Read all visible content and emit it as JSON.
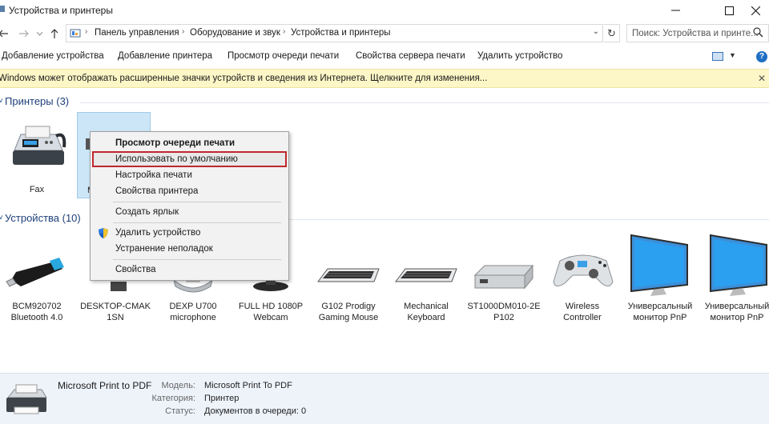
{
  "window": {
    "title": "Устройства и принтеры",
    "minimize_icon": "minimize-icon",
    "maximize_icon": "maximize-icon",
    "close_icon": "close-icon"
  },
  "address_bar": {
    "crumbs": [
      "Панель управления",
      "Оборудование и звук",
      "Устройства и принтеры"
    ],
    "search_placeholder": "Поиск: Устройства и принте..."
  },
  "command_bar": {
    "items": [
      "Добавление устройства",
      "Добавление принтера",
      "Просмотр очереди печати",
      "Свойства сервера печати",
      "Удалить устройство"
    ],
    "help_label": "?"
  },
  "info_bar": {
    "text": "Windows может отображать расширенные значки устройств и сведения из Интернета.  Щелкните для изменения..."
  },
  "printers": {
    "title": "Принтеры (3)",
    "items": [
      {
        "label": "Fax"
      },
      {
        "label": "M"
      }
    ]
  },
  "devices": {
    "title": "Устройства (10)",
    "items": [
      {
        "line1": "BCM920702",
        "line2": "Bluetooth 4.0"
      },
      {
        "line1": "DESKTOP-CMAK",
        "line2": "1SN"
      },
      {
        "line1": "DEXP U700",
        "line2": "microphone"
      },
      {
        "line1": "FULL HD 1080P",
        "line2": "Webcam"
      },
      {
        "line1": "G102 Prodigy",
        "line2": "Gaming Mouse"
      },
      {
        "line1": "Mechanical",
        "line2": "Keyboard"
      },
      {
        "line1": "ST1000DM010-2E",
        "line2": "P102"
      },
      {
        "line1": "Wireless",
        "line2": "Controller"
      },
      {
        "line1": "Универсальный",
        "line2": "монитор PnP"
      },
      {
        "line1": "Универсальный",
        "line2": "монитор PnP"
      }
    ]
  },
  "context_menu": {
    "items": [
      "Просмотр очереди печати",
      "Использовать по умолчанию",
      "Настройка печати",
      "Свойства принтера",
      "Создать ярлык",
      "Удалить устройство",
      "Устранение неполадок",
      "Свойства"
    ]
  },
  "details": {
    "name": "Microsoft Print to PDF",
    "model_label": "Модель:",
    "model_value": "Microsoft Print To PDF",
    "category_label": "Категория:",
    "category_value": "Принтер",
    "status_label": "Статус:",
    "status_value": "Документов в очереди: 0"
  },
  "colors": {
    "accent": "#1f6fc3",
    "selection": "#cde6f7",
    "infobar": "#fdf7c7",
    "highlight_border": "#c0272d"
  }
}
